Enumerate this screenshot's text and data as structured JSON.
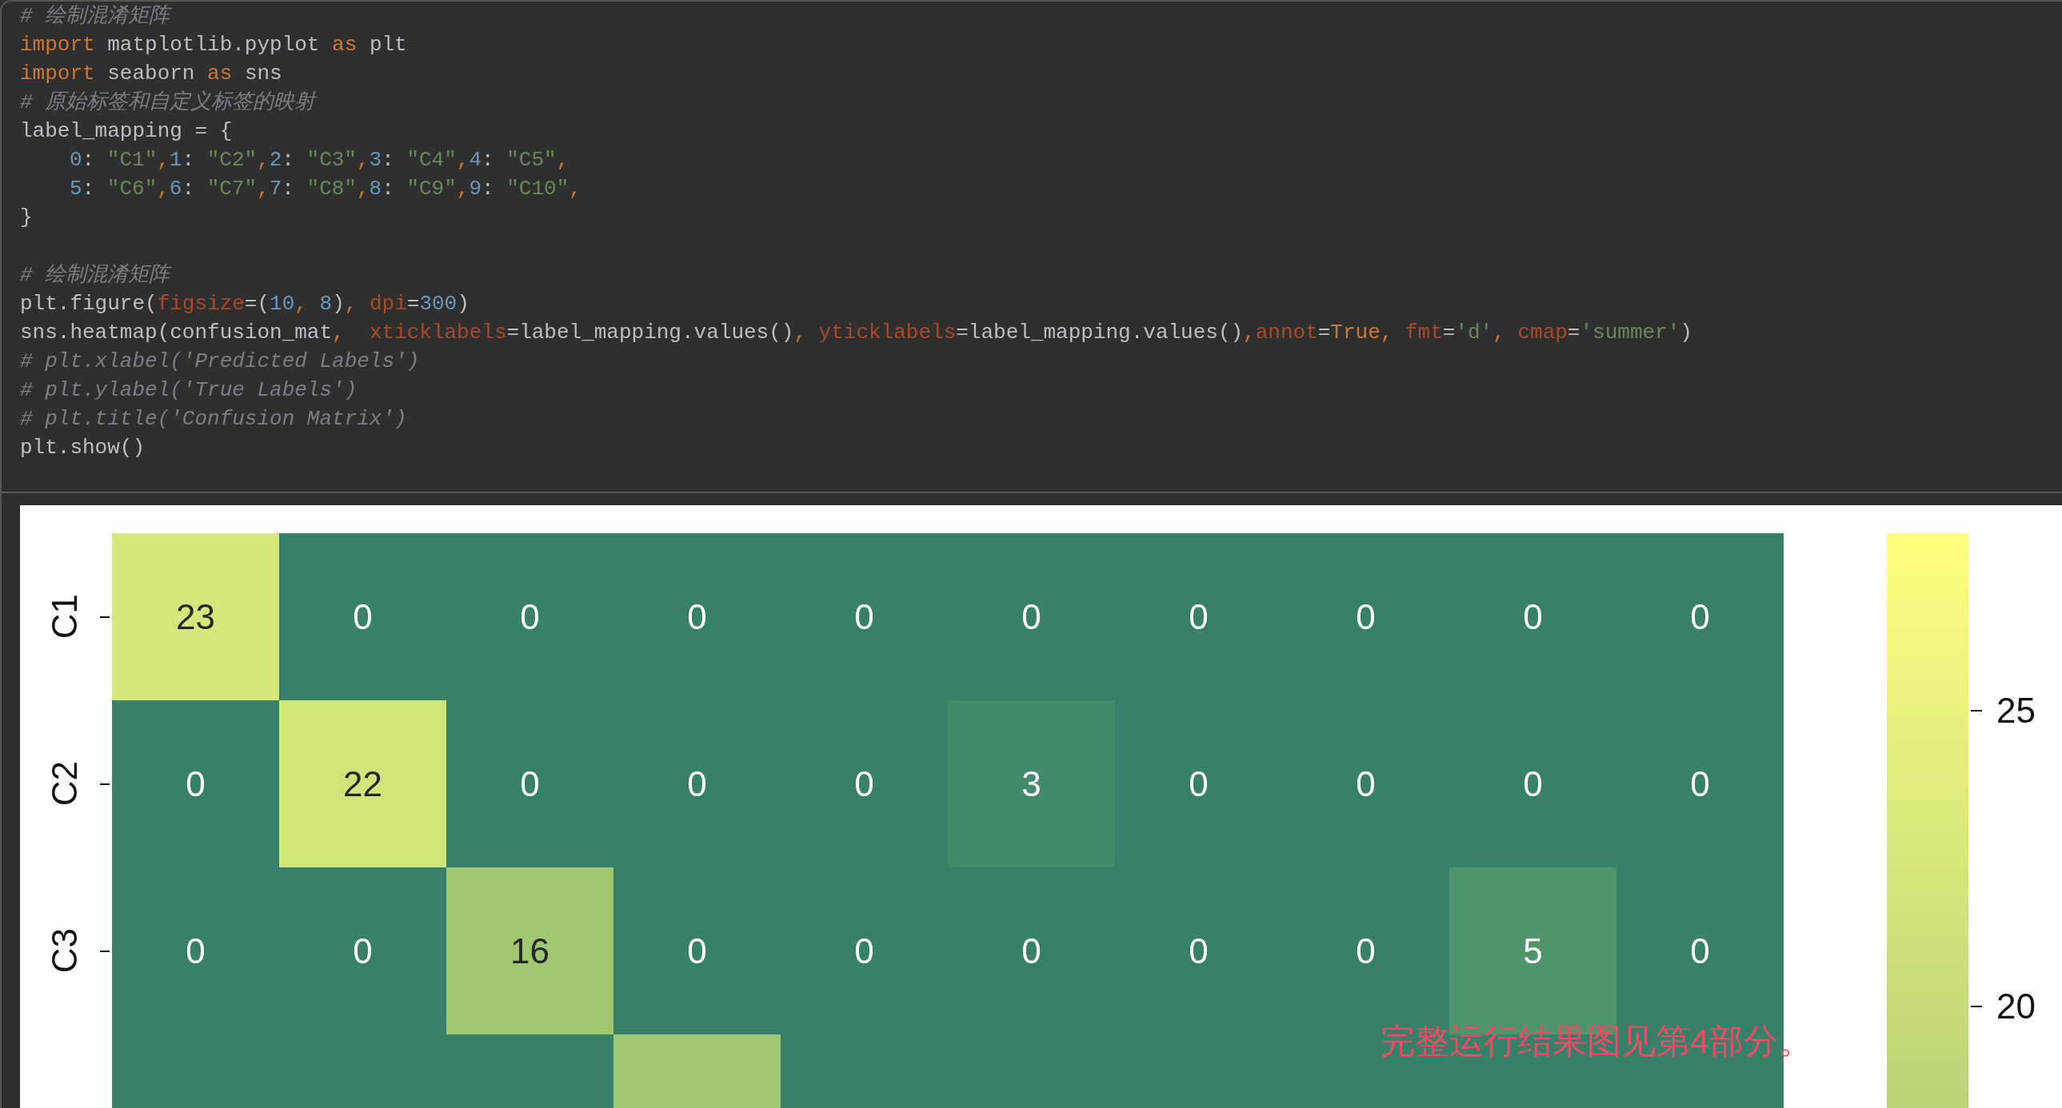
{
  "code_editor": {
    "blocks": [
      {
        "lines": [
          {
            "tokens": [
              {
                "kind": "comment",
                "text": "# 绘制混淆矩阵"
              }
            ]
          },
          {
            "tokens": [
              {
                "kind": "keyword",
                "text": "import"
              },
              {
                "kind": "plain",
                "text": " matplotlib.pyplot "
              },
              {
                "kind": "keyword",
                "text": "as"
              },
              {
                "kind": "plain",
                "text": " plt"
              }
            ]
          },
          {
            "tokens": [
              {
                "kind": "keyword",
                "text": "import"
              },
              {
                "kind": "plain",
                "text": " seaborn "
              },
              {
                "kind": "keyword",
                "text": "as"
              },
              {
                "kind": "plain",
                "text": " sns"
              }
            ]
          },
          {
            "tokens": [
              {
                "kind": "comment",
                "text": "# 原始标签和自定义标签的映射"
              }
            ]
          },
          {
            "tokens": [
              {
                "kind": "plain",
                "text": "label_mapping = {"
              }
            ],
            "children": [
              {
                "tokens": [
                  {
                    "kind": "number",
                    "text": "0"
                  },
                  {
                    "kind": "plain",
                    "text": ": "
                  },
                  {
                    "kind": "string",
                    "text": "\"C1\""
                  },
                  {
                    "kind": "punct",
                    "text": ","
                  },
                  {
                    "kind": "number",
                    "text": "1"
                  },
                  {
                    "kind": "plain",
                    "text": ": "
                  },
                  {
                    "kind": "string",
                    "text": "\"C2\""
                  },
                  {
                    "kind": "punct",
                    "text": ","
                  },
                  {
                    "kind": "number",
                    "text": "2"
                  },
                  {
                    "kind": "plain",
                    "text": ": "
                  },
                  {
                    "kind": "string",
                    "text": "\"C3\""
                  },
                  {
                    "kind": "punct",
                    "text": ","
                  },
                  {
                    "kind": "number",
                    "text": "3"
                  },
                  {
                    "kind": "plain",
                    "text": ": "
                  },
                  {
                    "kind": "string",
                    "text": "\"C4\""
                  },
                  {
                    "kind": "punct",
                    "text": ","
                  },
                  {
                    "kind": "number",
                    "text": "4"
                  },
                  {
                    "kind": "plain",
                    "text": ": "
                  },
                  {
                    "kind": "string",
                    "text": "\"C5\""
                  },
                  {
                    "kind": "punct",
                    "text": ","
                  }
                ]
              },
              {
                "tokens": [
                  {
                    "kind": "number",
                    "text": "5"
                  },
                  {
                    "kind": "plain",
                    "text": ": "
                  },
                  {
                    "kind": "string",
                    "text": "\"C6\""
                  },
                  {
                    "kind": "punct",
                    "text": ","
                  },
                  {
                    "kind": "number",
                    "text": "6"
                  },
                  {
                    "kind": "plain",
                    "text": ": "
                  },
                  {
                    "kind": "string",
                    "text": "\"C7\""
                  },
                  {
                    "kind": "punct",
                    "text": ","
                  },
                  {
                    "kind": "number",
                    "text": "7"
                  },
                  {
                    "kind": "plain",
                    "text": ": "
                  },
                  {
                    "kind": "string",
                    "text": "\"C8\""
                  },
                  {
                    "kind": "punct",
                    "text": ","
                  },
                  {
                    "kind": "number",
                    "text": "8"
                  },
                  {
                    "kind": "plain",
                    "text": ": "
                  },
                  {
                    "kind": "string",
                    "text": "\"C9\""
                  },
                  {
                    "kind": "punct",
                    "text": ","
                  },
                  {
                    "kind": "number",
                    "text": "9"
                  },
                  {
                    "kind": "plain",
                    "text": ": "
                  },
                  {
                    "kind": "string",
                    "text": "\"C10\""
                  },
                  {
                    "kind": "punct",
                    "text": ","
                  }
                ]
              }
            ]
          },
          {
            "tokens": [
              {
                "kind": "plain",
                "text": "}"
              }
            ]
          }
        ]
      },
      {
        "lines": [
          {
            "tokens": [
              {
                "kind": "comment",
                "text": "# 绘制混淆矩阵"
              }
            ]
          },
          {
            "tokens": [
              {
                "kind": "plain",
                "text": "plt.figure("
              },
              {
                "kind": "param",
                "text": "figsize"
              },
              {
                "kind": "plain",
                "text": "=("
              },
              {
                "kind": "number",
                "text": "10"
              },
              {
                "kind": "punct",
                "text": ", "
              },
              {
                "kind": "number",
                "text": "8"
              },
              {
                "kind": "plain",
                "text": ")"
              },
              {
                "kind": "punct",
                "text": ", "
              },
              {
                "kind": "param",
                "text": "dpi"
              },
              {
                "kind": "plain",
                "text": "="
              },
              {
                "kind": "number",
                "text": "300"
              },
              {
                "kind": "plain",
                "text": ")"
              }
            ]
          },
          {
            "tokens": [
              {
                "kind": "plain",
                "text": "sns.heatmap(confusion_mat"
              },
              {
                "kind": "punct",
                "text": ",  "
              },
              {
                "kind": "param",
                "text": "xticklabels"
              },
              {
                "kind": "plain",
                "text": "=label_mapping.values()"
              },
              {
                "kind": "punct",
                "text": ", "
              },
              {
                "kind": "param",
                "text": "yticklabels"
              },
              {
                "kind": "plain",
                "text": "=label_mapping.values()"
              },
              {
                "kind": "punct",
                "text": ","
              },
              {
                "kind": "param",
                "text": "annot"
              },
              {
                "kind": "plain",
                "text": "="
              },
              {
                "kind": "keyword",
                "text": "True"
              },
              {
                "kind": "punct",
                "text": ", "
              },
              {
                "kind": "param",
                "text": "fmt"
              },
              {
                "kind": "plain",
                "text": "="
              },
              {
                "kind": "string",
                "text": "'d'"
              },
              {
                "kind": "punct",
                "text": ", "
              },
              {
                "kind": "param",
                "text": "cmap"
              },
              {
                "kind": "plain",
                "text": "="
              },
              {
                "kind": "string",
                "text": "'summer'"
              },
              {
                "kind": "plain",
                "text": ")"
              }
            ]
          },
          {
            "tokens": [
              {
                "kind": "comment",
                "text": "# plt.xlabel('Predicted Labels')"
              }
            ]
          },
          {
            "tokens": [
              {
                "kind": "comment",
                "text": "# plt.ylabel('True Labels')"
              }
            ]
          },
          {
            "tokens": [
              {
                "kind": "comment",
                "text": "# plt.title('Confusion Matrix')"
              }
            ]
          },
          {
            "tokens": [
              {
                "kind": "plain",
                "text": "plt.show()"
              }
            ]
          }
        ]
      }
    ]
  },
  "output": {
    "heatmap": {
      "rows": [
        {
          "label": "C1",
          "cells": [
            {
              "kind": "cell",
              "value": "23",
              "color": "#d6e87a"
            },
            {
              "kind": "cell",
              "value": "0",
              "color": "#378069"
            },
            {
              "kind": "cell",
              "value": "0",
              "color": "#378069"
            },
            {
              "kind": "cell",
              "value": "0",
              "color": "#378069"
            },
            {
              "kind": "cell",
              "value": "0",
              "color": "#378069"
            },
            {
              "kind": "cell",
              "value": "0",
              "color": "#378069"
            },
            {
              "kind": "cell",
              "value": "0",
              "color": "#378069"
            },
            {
              "kind": "cell",
              "value": "0",
              "color": "#378069"
            },
            {
              "kind": "cell",
              "value": "0",
              "color": "#378069"
            },
            {
              "kind": "cell",
              "value": "0",
              "color": "#378069"
            }
          ]
        },
        {
          "label": "C2",
          "cells": [
            {
              "kind": "cell",
              "value": "0",
              "color": "#378069"
            },
            {
              "kind": "cell",
              "value": "22",
              "color": "#d0e67a"
            },
            {
              "kind": "cell",
              "value": "0",
              "color": "#378069"
            },
            {
              "kind": "cell",
              "value": "0",
              "color": "#378069"
            },
            {
              "kind": "cell",
              "value": "0",
              "color": "#378069"
            },
            {
              "kind": "cell",
              "value": "3",
              "color": "#438a6b"
            },
            {
              "kind": "cell",
              "value": "0",
              "color": "#378069"
            },
            {
              "kind": "cell",
              "value": "0",
              "color": "#378069"
            },
            {
              "kind": "cell",
              "value": "0",
              "color": "#378069"
            },
            {
              "kind": "cell",
              "value": "0",
              "color": "#378069"
            }
          ]
        },
        {
          "label": "C3",
          "cells": [
            {
              "kind": "cell",
              "value": "0",
              "color": "#378069"
            },
            {
              "kind": "cell",
              "value": "0",
              "color": "#378069"
            },
            {
              "kind": "cell",
              "value": "16",
              "color": "#a0c872"
            },
            {
              "kind": "cell",
              "value": "0",
              "color": "#378069"
            },
            {
              "kind": "cell",
              "value": "0",
              "color": "#378069"
            },
            {
              "kind": "cell",
              "value": "0",
              "color": "#378069"
            },
            {
              "kind": "cell",
              "value": "0",
              "color": "#378069"
            },
            {
              "kind": "cell",
              "value": "0",
              "color": "#378069"
            },
            {
              "kind": "cell",
              "value": "5",
              "color": "#50946b"
            },
            {
              "kind": "cell",
              "value": "0",
              "color": "#378069"
            }
          ]
        },
        {
          "color": "#378069",
          "cells": [
            {
              "kind": "ground"
            },
            {
              "kind": "ground"
            },
            {
              "kind": "ground"
            },
            {
              "kind": "cell",
              "color": "#a0c872"
            },
            {
              "kind": "ground"
            },
            {
              "kind": "ground"
            },
            {
              "kind": "ground"
            },
            {
              "kind": "ground"
            },
            {
              "kind": "ground"
            },
            {
              "kind": "ground"
            }
          ]
        }
      ]
    },
    "colorbar": {
      "tick_labels": [
        "25",
        "20"
      ]
    },
    "note": "完整运行结果图见第4部分。"
  }
}
